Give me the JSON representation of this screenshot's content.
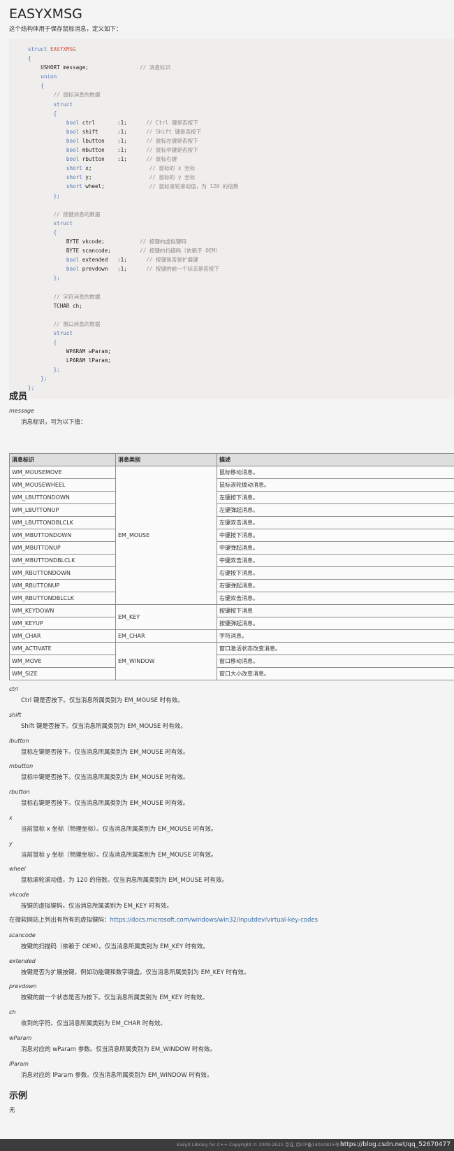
{
  "title": "EASYXMSG",
  "intro": "这个结构体用于保存鼠标消息，定义如下：",
  "code_lines": [
    [
      {
        "t": "struct ",
        "c": "kw"
      },
      {
        "t": "EASYXMSG",
        "c": "nm"
      }
    ],
    [
      {
        "t": "{",
        "c": "kw"
      }
    ],
    [
      {
        "t": "    USHORT message;                ",
        "c": ""
      },
      {
        "t": "// 消息标识",
        "c": "cm"
      }
    ],
    [
      {
        "t": "    ",
        "c": ""
      },
      {
        "t": "union",
        "c": "kw"
      }
    ],
    [
      {
        "t": "    ",
        "c": ""
      },
      {
        "t": "{",
        "c": "kw"
      }
    ],
    [
      {
        "t": "        ",
        "c": ""
      },
      {
        "t": "// 鼠标消息的数据",
        "c": "cm"
      }
    ],
    [
      {
        "t": "        ",
        "c": ""
      },
      {
        "t": "struct",
        "c": "kw"
      }
    ],
    [
      {
        "t": "        ",
        "c": ""
      },
      {
        "t": "{",
        "c": "kw"
      }
    ],
    [
      {
        "t": "            ",
        "c": ""
      },
      {
        "t": "bool",
        "c": "kw"
      },
      {
        "t": " ctrl       :1;      ",
        "c": ""
      },
      {
        "t": "// Ctrl 键是否按下",
        "c": "cm"
      }
    ],
    [
      {
        "t": "            ",
        "c": ""
      },
      {
        "t": "bool",
        "c": "kw"
      },
      {
        "t": " shift      :1;      ",
        "c": ""
      },
      {
        "t": "// Shift 键是否按下",
        "c": "cm"
      }
    ],
    [
      {
        "t": "            ",
        "c": ""
      },
      {
        "t": "bool",
        "c": "kw"
      },
      {
        "t": " lbutton    :1;      ",
        "c": ""
      },
      {
        "t": "// 鼠标左键是否按下",
        "c": "cm"
      }
    ],
    [
      {
        "t": "            ",
        "c": ""
      },
      {
        "t": "bool",
        "c": "kw"
      },
      {
        "t": " mbutton    :1;      ",
        "c": ""
      },
      {
        "t": "// 鼠标中键是否按下",
        "c": "cm"
      }
    ],
    [
      {
        "t": "            ",
        "c": ""
      },
      {
        "t": "bool",
        "c": "kw"
      },
      {
        "t": " rbutton    :1;      ",
        "c": ""
      },
      {
        "t": "// 鼠标右键",
        "c": "cm"
      }
    ],
    [
      {
        "t": "            ",
        "c": ""
      },
      {
        "t": "short",
        "c": "kw"
      },
      {
        "t": " x;                  ",
        "c": ""
      },
      {
        "t": "// 鼠标的 x 坐标",
        "c": "cm"
      }
    ],
    [
      {
        "t": "            ",
        "c": ""
      },
      {
        "t": "short",
        "c": "kw"
      },
      {
        "t": " y;                  ",
        "c": ""
      },
      {
        "t": "// 鼠标的 y 坐标",
        "c": "cm"
      }
    ],
    [
      {
        "t": "            ",
        "c": ""
      },
      {
        "t": "short",
        "c": "kw"
      },
      {
        "t": " wheel;              ",
        "c": ""
      },
      {
        "t": "// 鼠标滚轮滚动值，为 120 的倍数",
        "c": "cm"
      }
    ],
    [
      {
        "t": "        ",
        "c": ""
      },
      {
        "t": "};",
        "c": "kw"
      }
    ],
    [
      {
        "t": "",
        "c": ""
      }
    ],
    [
      {
        "t": "        ",
        "c": ""
      },
      {
        "t": "// 按键消息的数据",
        "c": "cm"
      }
    ],
    [
      {
        "t": "        ",
        "c": ""
      },
      {
        "t": "struct",
        "c": "kw"
      }
    ],
    [
      {
        "t": "        ",
        "c": ""
      },
      {
        "t": "{",
        "c": "kw"
      }
    ],
    [
      {
        "t": "            BYTE vkcode;           ",
        "c": ""
      },
      {
        "t": "// 按键的虚拟键码",
        "c": "cm"
      }
    ],
    [
      {
        "t": "            BYTE scancode;         ",
        "c": ""
      },
      {
        "t": "// 按键的扫描码（依赖于 OEM）",
        "c": "cm"
      }
    ],
    [
      {
        "t": "            ",
        "c": ""
      },
      {
        "t": "bool",
        "c": "kw"
      },
      {
        "t": " extended   :1;      ",
        "c": ""
      },
      {
        "t": "// 按键是否是扩展键",
        "c": "cm"
      }
    ],
    [
      {
        "t": "            ",
        "c": ""
      },
      {
        "t": "bool",
        "c": "kw"
      },
      {
        "t": " prevdown   :1;      ",
        "c": ""
      },
      {
        "t": "// 按键的前一个状态是否按下",
        "c": "cm"
      }
    ],
    [
      {
        "t": "        ",
        "c": ""
      },
      {
        "t": "};",
        "c": "kw"
      }
    ],
    [
      {
        "t": "",
        "c": ""
      }
    ],
    [
      {
        "t": "        ",
        "c": ""
      },
      {
        "t": "// 字符消息的数据",
        "c": "cm"
      }
    ],
    [
      {
        "t": "        TCHAR ch;",
        "c": ""
      }
    ],
    [
      {
        "t": "",
        "c": ""
      }
    ],
    [
      {
        "t": "        ",
        "c": ""
      },
      {
        "t": "// 窗口消息的数据",
        "c": "cm"
      }
    ],
    [
      {
        "t": "        ",
        "c": ""
      },
      {
        "t": "struct",
        "c": "kw"
      }
    ],
    [
      {
        "t": "        ",
        "c": ""
      },
      {
        "t": "{",
        "c": "kw"
      }
    ],
    [
      {
        "t": "            WPARAM wParam;",
        "c": ""
      }
    ],
    [
      {
        "t": "            LPARAM lParam;",
        "c": ""
      }
    ],
    [
      {
        "t": "        ",
        "c": ""
      },
      {
        "t": "};",
        "c": "kw"
      }
    ],
    [
      {
        "t": "    ",
        "c": ""
      },
      {
        "t": "};",
        "c": "kw"
      }
    ],
    [
      {
        "t": "};",
        "c": "kw"
      }
    ]
  ],
  "members_heading": "成员",
  "message_term": "message",
  "message_desc": "消息标识，可为以下值：",
  "table": {
    "headers": [
      "消息标识",
      "消息类别",
      "描述"
    ],
    "groups": [
      {
        "category": "EM_MOUSE",
        "rows": [
          [
            "WM_MOUSEMOVE",
            "鼠标移动消息。"
          ],
          [
            "WM_MOUSEWHEEL",
            "鼠标滚轮拨动消息。"
          ],
          [
            "WM_LBUTTONDOWN",
            "左键按下消息。"
          ],
          [
            "WM_LBUTTONUP",
            "左键弹起消息。"
          ],
          [
            "WM_LBUTTONDBLCLK",
            "左键双击消息。"
          ],
          [
            "WM_MBUTTONDOWN",
            "中键按下消息。"
          ],
          [
            "WM_MBUTTONUP",
            "中键弹起消息。"
          ],
          [
            "WM_MBUTTONDBLCLK",
            "中键双击消息。"
          ],
          [
            "WM_RBUTTONDOWN",
            "右键按下消息。"
          ],
          [
            "WM_RBUTTONUP",
            "右键弹起消息。"
          ],
          [
            "WM_RBUTTONDBLCLK",
            "右键双击消息。"
          ]
        ]
      },
      {
        "category": "EM_KEY",
        "rows": [
          [
            "WM_KEYDOWN",
            "按键按下消息"
          ],
          [
            "WM_KEYUP",
            "按键弹起消息。"
          ]
        ]
      },
      {
        "category": "EM_CHAR",
        "rows": [
          [
            "WM_CHAR",
            "字符消息。"
          ]
        ]
      },
      {
        "category": "EM_WINDOW",
        "rows": [
          [
            "WM_ACTIVATE",
            "窗口激活状态改变消息。"
          ],
          [
            "WM_MOVE",
            "窗口移动消息。"
          ],
          [
            "WM_SIZE",
            "窗口大小改变消息。"
          ]
        ]
      }
    ]
  },
  "members": {
    "ctrl": {
      "term": "ctrl",
      "desc": "Ctrl 键是否按下。仅当消息所属类别为 EM_MOUSE 时有效。"
    },
    "shift": {
      "term": "shift",
      "desc": "Shift 键是否按下。仅当消息所属类别为 EM_MOUSE 时有效。"
    },
    "lbutton": {
      "term": "lbutton",
      "desc": "鼠标左键是否按下。仅当消息所属类别为 EM_MOUSE 时有效。"
    },
    "mbutton": {
      "term": "mbutton",
      "desc": "鼠标中键是否按下。仅当消息所属类别为 EM_MOUSE 时有效。"
    },
    "rbutton": {
      "term": "rbutton",
      "desc": "鼠标右键是否按下。仅当消息所属类别为 EM_MOUSE 时有效。"
    },
    "x": {
      "term": "x",
      "desc": "当前鼠标 x 坐标（物理坐标）。仅当消息所属类别为 EM_MOUSE 时有效。"
    },
    "y": {
      "term": "y",
      "desc": "当前鼠标 y 坐标（物理坐标）。仅当消息所属类别为 EM_MOUSE 时有效。"
    },
    "wheel": {
      "term": "wheel",
      "desc": "鼠标滚轮滚动值，为 120 的倍数。仅当消息所属类别为 EM_MOUSE 时有效。"
    },
    "vkcode": {
      "term": "vkcode",
      "desc": "按键的虚拟键码。仅当消息所属类别为 EM_KEY 时有效。"
    },
    "scancode": {
      "term": "scancode",
      "desc": "按键的扫描码（依赖于 OEM）。仅当消息所属类别为 EM_KEY 时有效。"
    },
    "extended": {
      "term": "extended",
      "desc": "按键是否为扩展按键，例如功能键和数字键盘。仅当消息所属类别为 EM_KEY 时有效。"
    },
    "prevdown": {
      "term": "prevdown",
      "desc": "按键的前一个状态是否为按下。仅当消息所属类别为 EM_KEY 时有效。"
    },
    "ch": {
      "term": "ch",
      "desc": "收到的字符。仅当消息所属类别为 EM_CHAR 时有效。"
    },
    "wParam": {
      "term": "wParam",
      "desc": "消息对应的 wParam 参数。仅当消息所属类别为 EM_WINDOW 时有效。"
    },
    "lParam": {
      "term": "lParam",
      "desc": "消息对应的 lParam 参数。仅当消息所属类别为 EM_WINDOW 时有效。"
    }
  },
  "vk_note": {
    "prefix": "在微软网站上列出有所有的虚拟键码：",
    "link": "https://docs.microsoft.com/windows/win32/inputdev/virtual-key-codes"
  },
  "example_heading": "示例",
  "example_body": "无",
  "footer_text": "EasyX Library for C++ Copyright © 2009-2021 京在    京ICP备14010815号-1",
  "watermark": "https://blog.csdn.net/qq_52670477"
}
